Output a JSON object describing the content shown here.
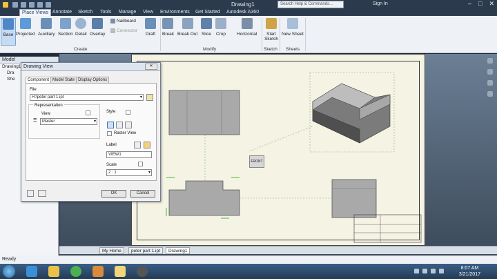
{
  "window": {
    "title": "Drawing1",
    "search_placeholder": "Search Help & Commands...",
    "signin": "Sign In"
  },
  "ribbon_tabs": [
    "Place Views",
    "Annotate",
    "Sketch",
    "Tools",
    "Manage",
    "View",
    "Environments",
    "Get Started",
    "Autodesk A360"
  ],
  "ribbon": {
    "create": {
      "base": "Base",
      "projected": "Projected",
      "auxiliary": "Auxiliary",
      "section": "Section",
      "detail": "Detail",
      "overlay": "Overlay",
      "nailboard": "Nailboard",
      "connector": "Connector",
      "draft": "Draft",
      "label": "Create"
    },
    "modify": {
      "break": "Break",
      "break_out": "Break Out",
      "slice": "Slice",
      "crop": "Crop",
      "horizontal": "Horizontal",
      "label": "Modify"
    },
    "sketch": {
      "start_sketch": "Start Sketch",
      "label": "Sketch"
    },
    "sheets": {
      "new_sheet": "New Sheet",
      "label": "Sheets"
    }
  },
  "browser": {
    "header": "Model",
    "items": [
      "Drawing1",
      "Dra",
      "She"
    ]
  },
  "dialog": {
    "title": "Drawing View",
    "tabs": [
      "Component",
      "Model State",
      "Display Options"
    ],
    "file_label": "File",
    "file_value": "H:\\peter part 1.ipt",
    "representation_label": "Representation",
    "view_label": "View",
    "view_value": "Master",
    "style_label": "Style",
    "raster_view_label": "Raster View",
    "label_label": "Label",
    "label_value": "VIEW1",
    "scale_label": "Scale",
    "scale_value": "2 : 1",
    "ok": "OK",
    "cancel": "Cancel"
  },
  "viewport": {
    "front_label": "FRONT"
  },
  "doc_tabs": [
    "My Home",
    "peter part 1.ipt",
    "Drawing1"
  ],
  "status": "Ready",
  "clock": {
    "time": "8:07 AM",
    "date": "3/21/2017"
  }
}
